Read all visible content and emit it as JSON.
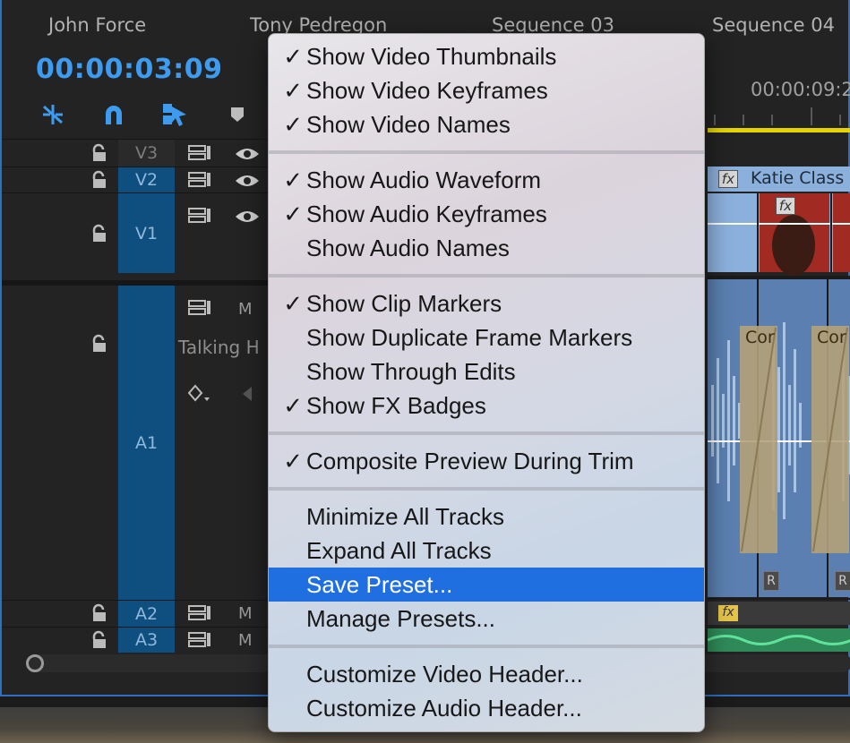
{
  "sequence_tabs": [
    "John Force",
    "Tony Pedregon",
    "Sequence 03",
    "Sequence 04"
  ],
  "timecode": "00:00:03:09",
  "ruler_time": "00:00:09:2",
  "tracks": {
    "v3": "V3",
    "v2": "V2",
    "v1": "V1",
    "a1": "A1",
    "a2": "A2",
    "a3": "A3",
    "mute_label": "M"
  },
  "a1_track_name": "Talking H",
  "clips": {
    "v2_clip_name": "Katie Class",
    "fx_badge": "fx",
    "a1_clip_label": "Cor",
    "r_badge": "R"
  },
  "colors": {
    "accent": "#3d9bf0",
    "track_label_active": "#0f4f7f",
    "highlight": "#1f6fe0",
    "work_area": "#e6d400",
    "video_clip": "#8bb0dc",
    "audio_clip": "#5a7fb0",
    "audio_a3": "#3fae6f"
  },
  "menu": {
    "items": [
      {
        "label": "Show Video Thumbnails",
        "check": "✓"
      },
      {
        "label": "Show Video Keyframes",
        "check": "✓"
      },
      {
        "label": "Show Video Names",
        "check": "✓"
      },
      {
        "label": "Show Audio Waveform",
        "check": "✓"
      },
      {
        "label": "Show Audio Keyframes",
        "check": "✓"
      },
      {
        "label": "Show Audio Names",
        "check": ""
      },
      {
        "label": "Show Clip Markers",
        "check": "✓"
      },
      {
        "label": "Show Duplicate Frame Markers",
        "check": ""
      },
      {
        "label": "Show Through Edits",
        "check": ""
      },
      {
        "label": "Show FX Badges",
        "check": "✓"
      },
      {
        "label": "Composite Preview During Trim",
        "check": "✓"
      },
      {
        "label": "Minimize All Tracks",
        "check": ""
      },
      {
        "label": "Expand All Tracks",
        "check": ""
      },
      {
        "label": "Save Preset...",
        "check": ""
      },
      {
        "label": "Manage Presets...",
        "check": ""
      },
      {
        "label": "Customize Video Header...",
        "check": ""
      },
      {
        "label": "Customize Audio Header...",
        "check": ""
      }
    ]
  }
}
